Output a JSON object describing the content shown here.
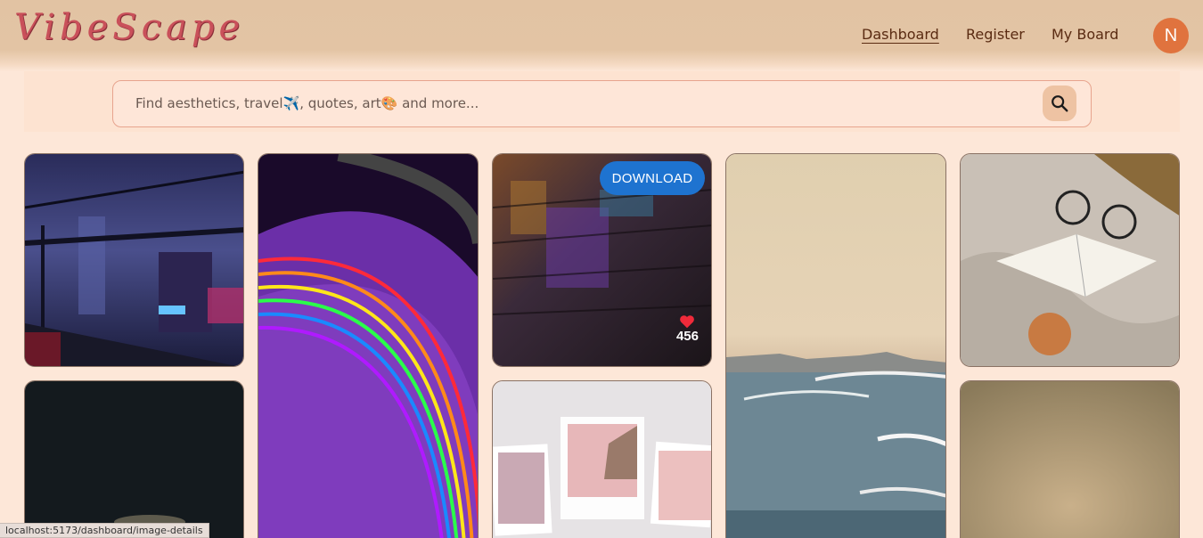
{
  "app": {
    "logo": "VibeScape"
  },
  "nav": {
    "links": [
      {
        "label": "Dashboard",
        "active": true
      },
      {
        "label": "Register",
        "active": false
      },
      {
        "label": "My Board",
        "active": false
      }
    ],
    "avatar_initial": "N"
  },
  "search": {
    "placeholder": "Find aesthetics, travel✈️, quotes, art🎨 and more...",
    "icon": "search-icon"
  },
  "gallery": {
    "hover_card": {
      "download_label": "DOWNLOAD",
      "like_count": "456",
      "like_icon": "heart-icon"
    }
  },
  "status_bar": {
    "url": "localhost:5173/dashboard/image-details"
  },
  "colors": {
    "navbar": "#e3c4a4",
    "logo": "#c9505a",
    "avatar": "#e0733e",
    "download_button": "#1e73d0"
  }
}
